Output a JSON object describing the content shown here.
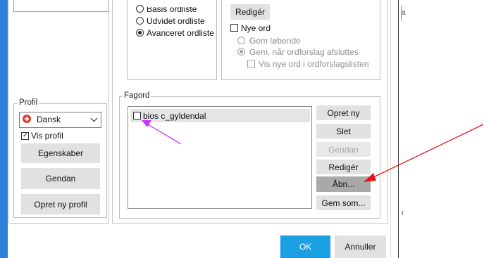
{
  "colors": {
    "accent": "#1ba1e2",
    "annotation_arrow": "#e8131b",
    "annotation_arrow_purple": "#cc33ff"
  },
  "options": {
    "radio_basis": "Basis ordliste",
    "radio_udvidet": "Udvidet ordliste",
    "radio_avanceret": "Avanceret ordliste",
    "edit_button": "Redigér",
    "new_words": "Nye ord",
    "save_running": "Gem løbende",
    "save_on_finish": "Gem, når ordforslag afsluttes",
    "show_new_words": "Vis nye ord i ordforslagslisten"
  },
  "profile": {
    "legend": "Profil",
    "selected_language": "Dansk",
    "show_profile": "Vis profil",
    "properties_button": "Egenskaber",
    "restore_button": "Gendan",
    "new_profile_button": "Opret ny profil"
  },
  "fagord": {
    "legend": "Fagord",
    "items": [
      {
        "label": "bios c_gyldendal",
        "checked": false
      }
    ],
    "buttons": {
      "create": "Opret ny",
      "delete": "Slet",
      "restore": "Gendan",
      "edit": "Redigér",
      "open": "Åbn...",
      "save_as": "Gem som..."
    }
  },
  "dialog": {
    "ok": "OK",
    "cancel": "Annuller"
  },
  "edge_marks": {
    "right_top": "ä",
    "right_bottom": "r"
  }
}
